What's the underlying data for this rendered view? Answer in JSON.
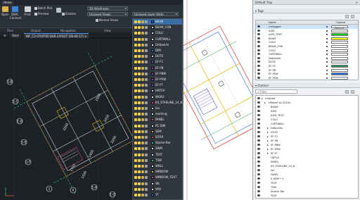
{
  "ribbon": {
    "tabs": [
      "Home"
    ],
    "buttons": {
      "open": "Open",
      "dwg_connect": "DWG\nConnect",
      "print": "Print",
      "preview": "Preview",
      "batch_plot": "Batch Plot",
      "extents": "Extents",
      "named_views": "Named Views"
    },
    "view_combo": "2D Wireframe",
    "view_combo2": "Unsaved Views",
    "layer_combo": "Unsaved Layer State",
    "layer_current": "BEAM",
    "groups": [
      "Files",
      "Output",
      "Navigation",
      "View"
    ]
  },
  "doc_tabs": {
    "start": "Start",
    "drawing": "INF_C2-STARTER BAR LAYOUT (06-06-17)"
  },
  "layers": [
    {
      "name": "BEAM",
      "color": "#2f6fd6",
      "selected": true
    },
    {
      "name": "BEAM_CON",
      "color": "#d8d8d8"
    },
    {
      "name": "COLU",
      "color": "#f0f0f0"
    },
    {
      "name": "CURTWALL",
      "color": "#ffffff"
    },
    {
      "name": "Defpoints",
      "color": "#f0f0f0"
    },
    {
      "name": "DIM",
      "color": "#2f6fd6"
    },
    {
      "name": "DOTE",
      "color": "#d0d0d0"
    },
    {
      "name": "EF-FC",
      "color": "#8e44ad"
    },
    {
      "name": "EF-PB",
      "color": "#8e44ad"
    },
    {
      "name": "EF-PBW",
      "color": "#8e44ad"
    },
    {
      "name": "EF-PSW",
      "color": "#8e44ad"
    },
    {
      "name": "EF-YT",
      "color": "#8e44ad"
    },
    {
      "name": "HATCH",
      "color": "#cfcfcf"
    },
    {
      "name": "INSRU",
      "color": "#f2f2f2"
    },
    {
      "name": "KS_STARLINE_24_N",
      "color": "#e84393"
    },
    {
      "name": "lan",
      "color": "#d0d0d0"
    },
    {
      "name": "marking",
      "color": "#f2f2f2"
    },
    {
      "name": "PANEL",
      "color": "#e74c3c"
    },
    {
      "name": "PC DIM",
      "color": "#f2f2f2"
    },
    {
      "name": "SEM",
      "color": "#f39c12"
    },
    {
      "name": "SITAR",
      "color": "#e74c3c"
    },
    {
      "name": "Starter-Bar",
      "color": "#2ecc71"
    },
    {
      "name": "SWM",
      "color": "#f2f2f2"
    },
    {
      "name": "TEXT",
      "color": "#f2f2f2"
    },
    {
      "name": "TSW",
      "color": "#2ecc71"
    },
    {
      "name": "WALL",
      "color": "#f2f2f2"
    },
    {
      "name": "WINDOW",
      "color": "#f1c40f"
    },
    {
      "name": "WINDOW_TEXT",
      "color": "#e84393"
    },
    {
      "name": "WL",
      "color": "#f2f2f2"
    },
    {
      "name": "WW",
      "color": "#f2f2f2"
    },
    {
      "name": "YT",
      "color": "#2f6fd6"
    }
  ],
  "tray": {
    "title": "Default Tray",
    "tags_header": "Tags",
    "tags_columns": {
      "name": "Name",
      "outline": "Outline",
      "default": "Default"
    },
    "tags": [
      {
        "name": "Untagged",
        "color": "#ffffff"
      },
      {
        "name": "AXIS",
        "color": "#ffffff"
      },
      {
        "name": "AXIS_TEXT",
        "color": "#00cc00"
      },
      {
        "name": "BEAM",
        "color": "#ffff00"
      },
      {
        "name": "COLU",
        "color": "#ffffff"
      },
      {
        "name": "BEAM_CON",
        "color": "#ffffff"
      },
      {
        "name": "COLU",
        "color": "#ffffff"
      },
      {
        "name": "CURTWALL",
        "color": "#ffffff"
      },
      {
        "name": "Defpoints",
        "color": "#ffffff"
      },
      {
        "name": "DOTE",
        "color": "#ffffff"
      },
      {
        "name": "EF-FC",
        "color": "#2e8b57"
      },
      {
        "name": "EF-PB",
        "color": "#ffffff"
      },
      {
        "name": "EF-PSW",
        "color": "#2a6bd6"
      },
      {
        "name": "EF-PSW",
        "color": "#ffffff"
      }
    ],
    "outliner_header": "Outliner",
    "search_placeholder": "Filter",
    "outliner": [
      {
        "label": "Untitled",
        "indent": 0
      },
      {
        "label": "<Model Vp 2024>",
        "indent": 1
      },
      {
        "label": "BEAM",
        "indent": 2
      },
      {
        "label": "AXIS",
        "indent": 2
      },
      {
        "label": "AXIS_TEXT",
        "indent": 2
      },
      {
        "label": "COLU",
        "indent": 2
      },
      {
        "label": "CURTWALL",
        "indent": 2
      },
      {
        "label": "Defpoints",
        "indent": 2
      },
      {
        "label": "DOTE",
        "indent": 2
      },
      {
        "label": "EF-FC",
        "indent": 2
      },
      {
        "label": "EF-PB",
        "indent": 2
      },
      {
        "label": "EF-PBW",
        "indent": 2
      },
      {
        "label": "EF-PSW",
        "indent": 2
      },
      {
        "label": "EF-YT",
        "indent": 2
      },
      {
        "label": "HATCH",
        "indent": 2
      },
      {
        "label": "INSRU",
        "indent": 2
      },
      {
        "label": "KS_STARLINE_24_N",
        "indent": 2
      },
      {
        "label": "lan",
        "indent": 2
      },
      {
        "label": "FAKEL",
        "indent": 2
      },
      {
        "label": "E_BEM • 2",
        "indent": 2
      },
      {
        "label": "TEXT",
        "indent": 2
      },
      {
        "label": "TSW",
        "indent": 2
      },
      {
        "label": "Starter Bar",
        "indent": 2
      },
      {
        "label": "TEXT",
        "indent": 2
      }
    ]
  },
  "dims": [
    "3200",
    "1750",
    "1500",
    "1400",
    "2500",
    "3350",
    "3200"
  ],
  "axis_labels": [
    "1-B",
    "1-C",
    "1-D",
    "1-E",
    "1-F",
    "2",
    "A",
    "1-A",
    "1-G"
  ]
}
